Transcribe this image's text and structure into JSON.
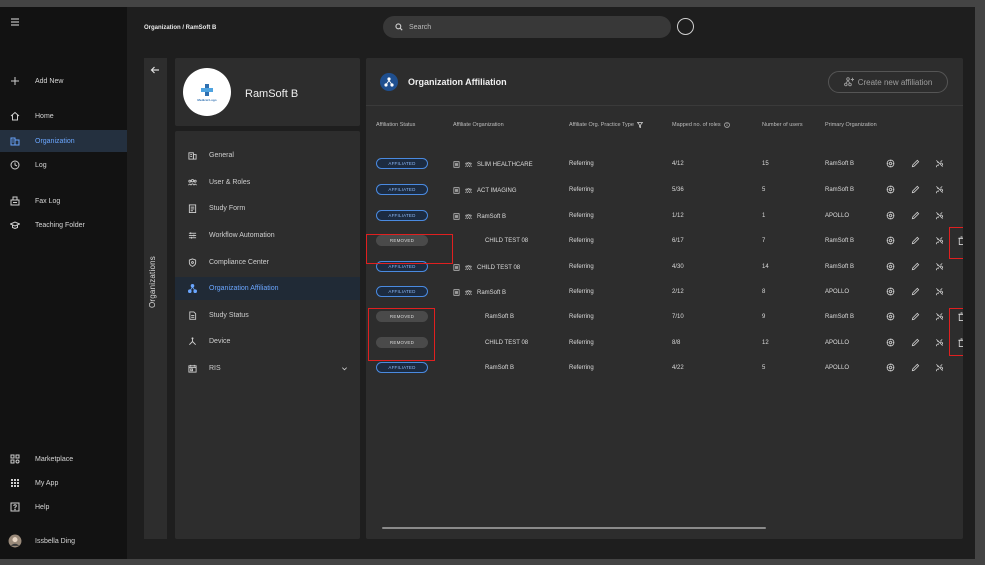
{
  "leftnav": {
    "items": [
      {
        "label": "Add New",
        "icon": "plus-icon"
      },
      {
        "label": "Home",
        "icon": "home-icon"
      },
      {
        "label": "Organization",
        "icon": "organization-icon"
      },
      {
        "label": "Log",
        "icon": "log-icon"
      },
      {
        "label": "Fax Log",
        "icon": "fax-icon"
      },
      {
        "label": "Teaching Folder",
        "icon": "graduation-cap-icon"
      },
      {
        "label": "Marketplace",
        "icon": "marketplace-icon"
      },
      {
        "label": "My App",
        "icon": "apps-grid-icon"
      },
      {
        "label": "Help",
        "icon": "help-icon"
      },
      {
        "label": "Issbella Ding",
        "icon": "avatar"
      }
    ],
    "active": "Organization"
  },
  "header": {
    "breadcrumb": "Organization / RamSoft B",
    "search_placeholder": "Search"
  },
  "org": {
    "strip_label": "Organizations",
    "name": "RamSoft B",
    "logo_text": "Medical Logo"
  },
  "menu": {
    "items": [
      {
        "label": "General",
        "icon": "building-icon"
      },
      {
        "label": "User & Roles",
        "icon": "users-icon"
      },
      {
        "label": "Study Form",
        "icon": "form-icon"
      },
      {
        "label": "Workflow Automation",
        "icon": "sliders-icon"
      },
      {
        "label": "Compliance Center",
        "icon": "shield-icon"
      },
      {
        "label": "Organization Affiliation",
        "icon": "hierarchy-icon"
      },
      {
        "label": "Study Status",
        "icon": "document-icon"
      },
      {
        "label": "Device",
        "icon": "device-icon"
      },
      {
        "label": "RIS",
        "icon": "calendar-icon"
      }
    ],
    "active": "Organization Affiliation"
  },
  "panel": {
    "title": "Organization Affiliation",
    "create_label": "Create new affiliation",
    "columns": [
      "Affiliation Status",
      "Affiliate Organization",
      "Affiliate Org. Practice Type",
      "Mapped no. of roles",
      "Number of users",
      "Primary Organization"
    ],
    "rows": [
      {
        "status": "AFFILIATED",
        "org": "SLIM HEALTHCARE",
        "type": "Referring",
        "roles": "4/12",
        "users": "15",
        "primary": "RamSoft B",
        "icons": true,
        "delete": false
      },
      {
        "status": "AFFILIATED",
        "org": "ACT IMAGING",
        "type": "Referring",
        "roles": "5/36",
        "users": "5",
        "primary": "RamSoft B",
        "icons": true,
        "delete": false
      },
      {
        "status": "AFFILIATED",
        "org": "RamSoft B",
        "type": "Referring",
        "roles": "1/12",
        "users": "1",
        "primary": "APOLLO",
        "icons": true,
        "delete": false
      },
      {
        "status": "REMOVED",
        "org": "CHILD TEST 08",
        "type": "Referring",
        "roles": "6/17",
        "users": "7",
        "primary": "RamSoft B",
        "icons": false,
        "delete": true
      },
      {
        "status": "AFFILIATED",
        "org": "CHILD TEST 08",
        "type": "Referring",
        "roles": "4/30",
        "users": "14",
        "primary": "RamSoft B",
        "icons": true,
        "delete": false
      },
      {
        "status": "AFFILIATED",
        "org": "RamSoft B",
        "type": "Referring",
        "roles": "2/12",
        "users": "8",
        "primary": "APOLLO",
        "icons": true,
        "delete": false
      },
      {
        "status": "REMOVED",
        "org": "RamSoft B",
        "type": "Referring",
        "roles": "7/10",
        "users": "9",
        "primary": "RamSoft B",
        "icons": false,
        "delete": true
      },
      {
        "status": "REMOVED",
        "org": "CHILD TEST 08",
        "type": "Referring",
        "roles": "8/8",
        "users": "12",
        "primary": "APOLLO",
        "icons": false,
        "delete": true
      },
      {
        "status": "AFFILIATED",
        "org": "RamSoft B",
        "type": "Referring",
        "roles": "4/22",
        "users": "5",
        "primary": "APOLLO",
        "icons": false,
        "delete": false
      }
    ]
  },
  "colors": {
    "accent": "#6aa6ff",
    "badge_border": "#4a8ae0",
    "highlight": "#e02020",
    "background": "#1e1e1e",
    "panel": "#2d2d2d"
  }
}
